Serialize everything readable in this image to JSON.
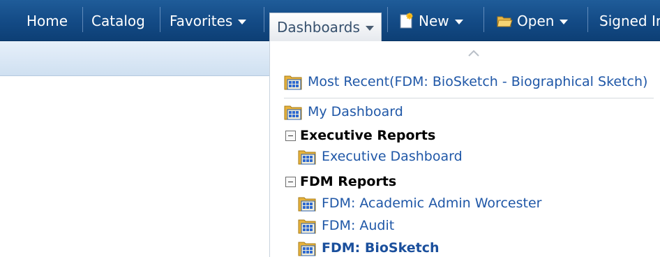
{
  "nav": {
    "home": "Home",
    "catalog": "Catalog",
    "favorites": "Favorites",
    "dashboards": "Dashboards",
    "new": "New",
    "open": "Open",
    "signed_in": "Signed In"
  },
  "menu": {
    "most_recent": "Most Recent(FDM: BioSketch - Biographical Sketch)",
    "my_dashboard": "My Dashboard",
    "groups": [
      {
        "title": "Executive Reports",
        "items": [
          "Executive Dashboard"
        ]
      },
      {
        "title": "FDM Reports",
        "items": [
          "FDM: Academic Admin Worcester",
          "FDM: Audit",
          "FDM: BioSketch"
        ]
      }
    ]
  },
  "colors": {
    "navbar": "#134a85",
    "link": "#1f57a7",
    "subbar": "#dbe8f5"
  },
  "icons": {
    "dashboard": "dashboard-icon",
    "new": "new-document-icon",
    "open": "open-folder-icon",
    "scroll": "chevron-up-icon",
    "group_toggle": "collapse-icon"
  }
}
